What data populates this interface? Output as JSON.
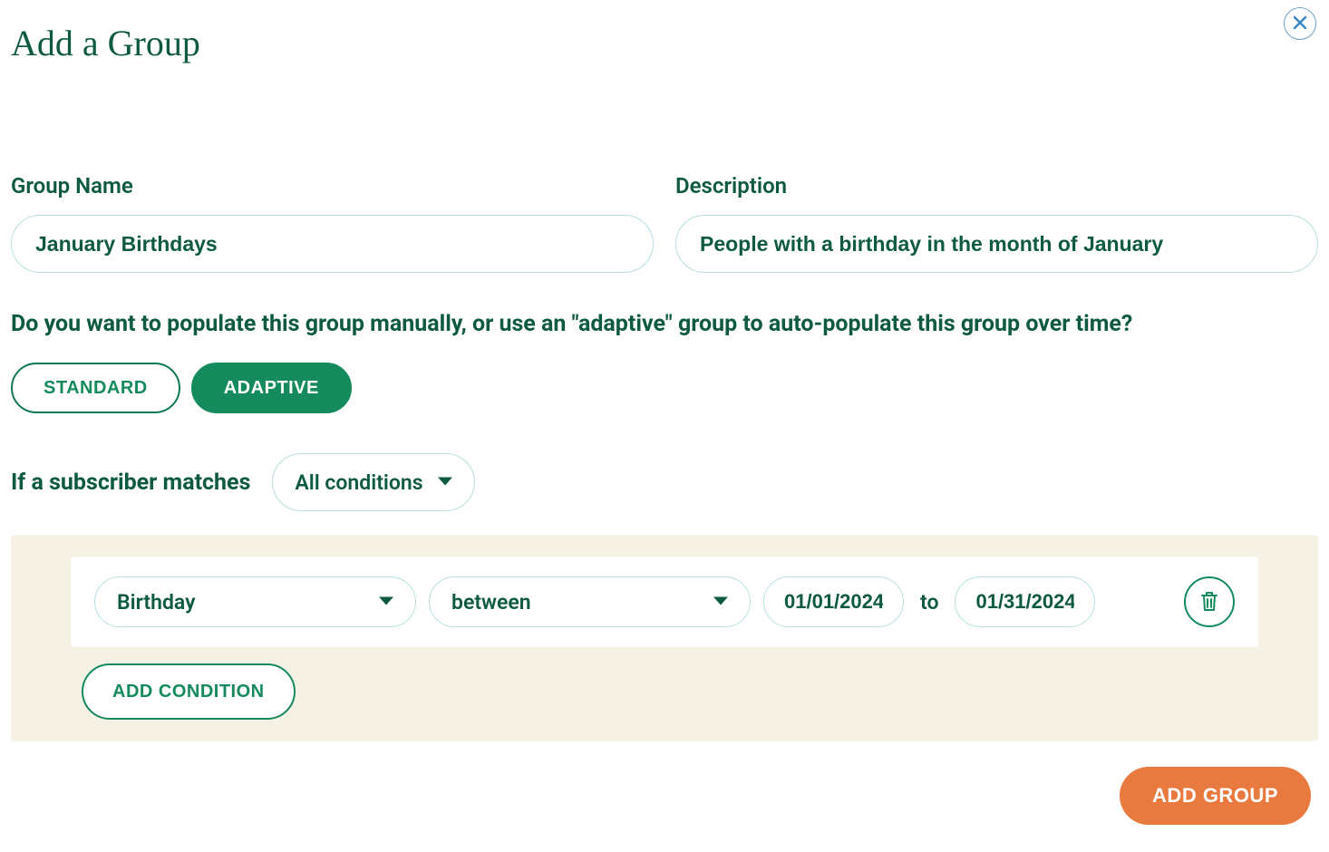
{
  "header": {
    "title": "Add a Group"
  },
  "form": {
    "groupName": {
      "label": "Group Name",
      "value": "January Birthdays"
    },
    "description": {
      "label": "Description",
      "value": "People with a birthday in the month of January"
    }
  },
  "populateQuestion": "Do you want to populate this group manually, or use an \"adaptive\" group to auto-populate this group over time?",
  "toggles": {
    "standard": "STANDARD",
    "adaptive": "ADAPTIVE",
    "selected": "adaptive"
  },
  "match": {
    "prefix": "If a subscriber matches",
    "mode": "All conditions"
  },
  "condition": {
    "field": "Birthday",
    "operator": "between",
    "date_from": "01/01/2024",
    "joiner": "to",
    "date_to": "01/31/2024"
  },
  "buttons": {
    "addCondition": "ADD CONDITION",
    "addGroup": "ADD GROUP"
  }
}
